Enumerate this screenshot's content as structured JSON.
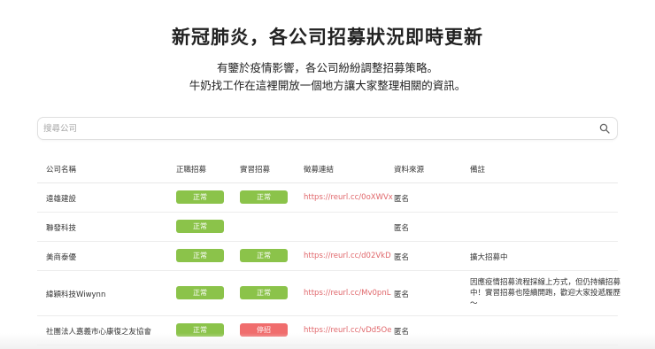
{
  "header": {
    "title": "新冠肺炎，各公司招募狀況即時更新",
    "line1": "有鑒於疫情影響，各公司紛紛調整招募策略。",
    "line2": "牛奶找工作在這裡開放一個地方讓大家整理相關的資訊。"
  },
  "search": {
    "placeholder": "搜尋公司",
    "value": ""
  },
  "table": {
    "headers": [
      "公司名稱",
      "正職招募",
      "實習招募",
      "徵募連結",
      "資料來源",
      "備註"
    ],
    "rows": [
      {
        "company": "遠雄建設",
        "fulltime": "正常",
        "intern": "正常",
        "link": "https://reurl.cc/0oXWVx",
        "source": "匿名",
        "note": ""
      },
      {
        "company": "聯發科技",
        "fulltime": "正常",
        "intern": "",
        "link": "",
        "source": "匿名",
        "note": ""
      },
      {
        "company": "美商泰優",
        "fulltime": "正常",
        "intern": "正常",
        "link": "https://reurl.cc/d02VkD",
        "source": "匿名",
        "note": "擴大招募中"
      },
      {
        "company": "緯穎科技Wiwynn",
        "fulltime": "正常",
        "intern": "正常",
        "link": "https://reurl.cc/Mv0pnL",
        "source": "匿名",
        "note": "因應疫情招募流程採線上方式，但仍持續招募中！實習招募也陸續開跑，歡迎大家投遞履歷～"
      },
      {
        "company": "社團法人嘉義市心康復之友協會",
        "fulltime": "正常",
        "intern": "停招",
        "link": "https://reurl.cc/vDd5Oe",
        "source": "匿名",
        "note": ""
      }
    ]
  },
  "colors": {
    "normal": "#8bc34a",
    "stopped": "#f06d6d",
    "link": "#e0676b"
  },
  "icons": {
    "search": "search-icon"
  }
}
